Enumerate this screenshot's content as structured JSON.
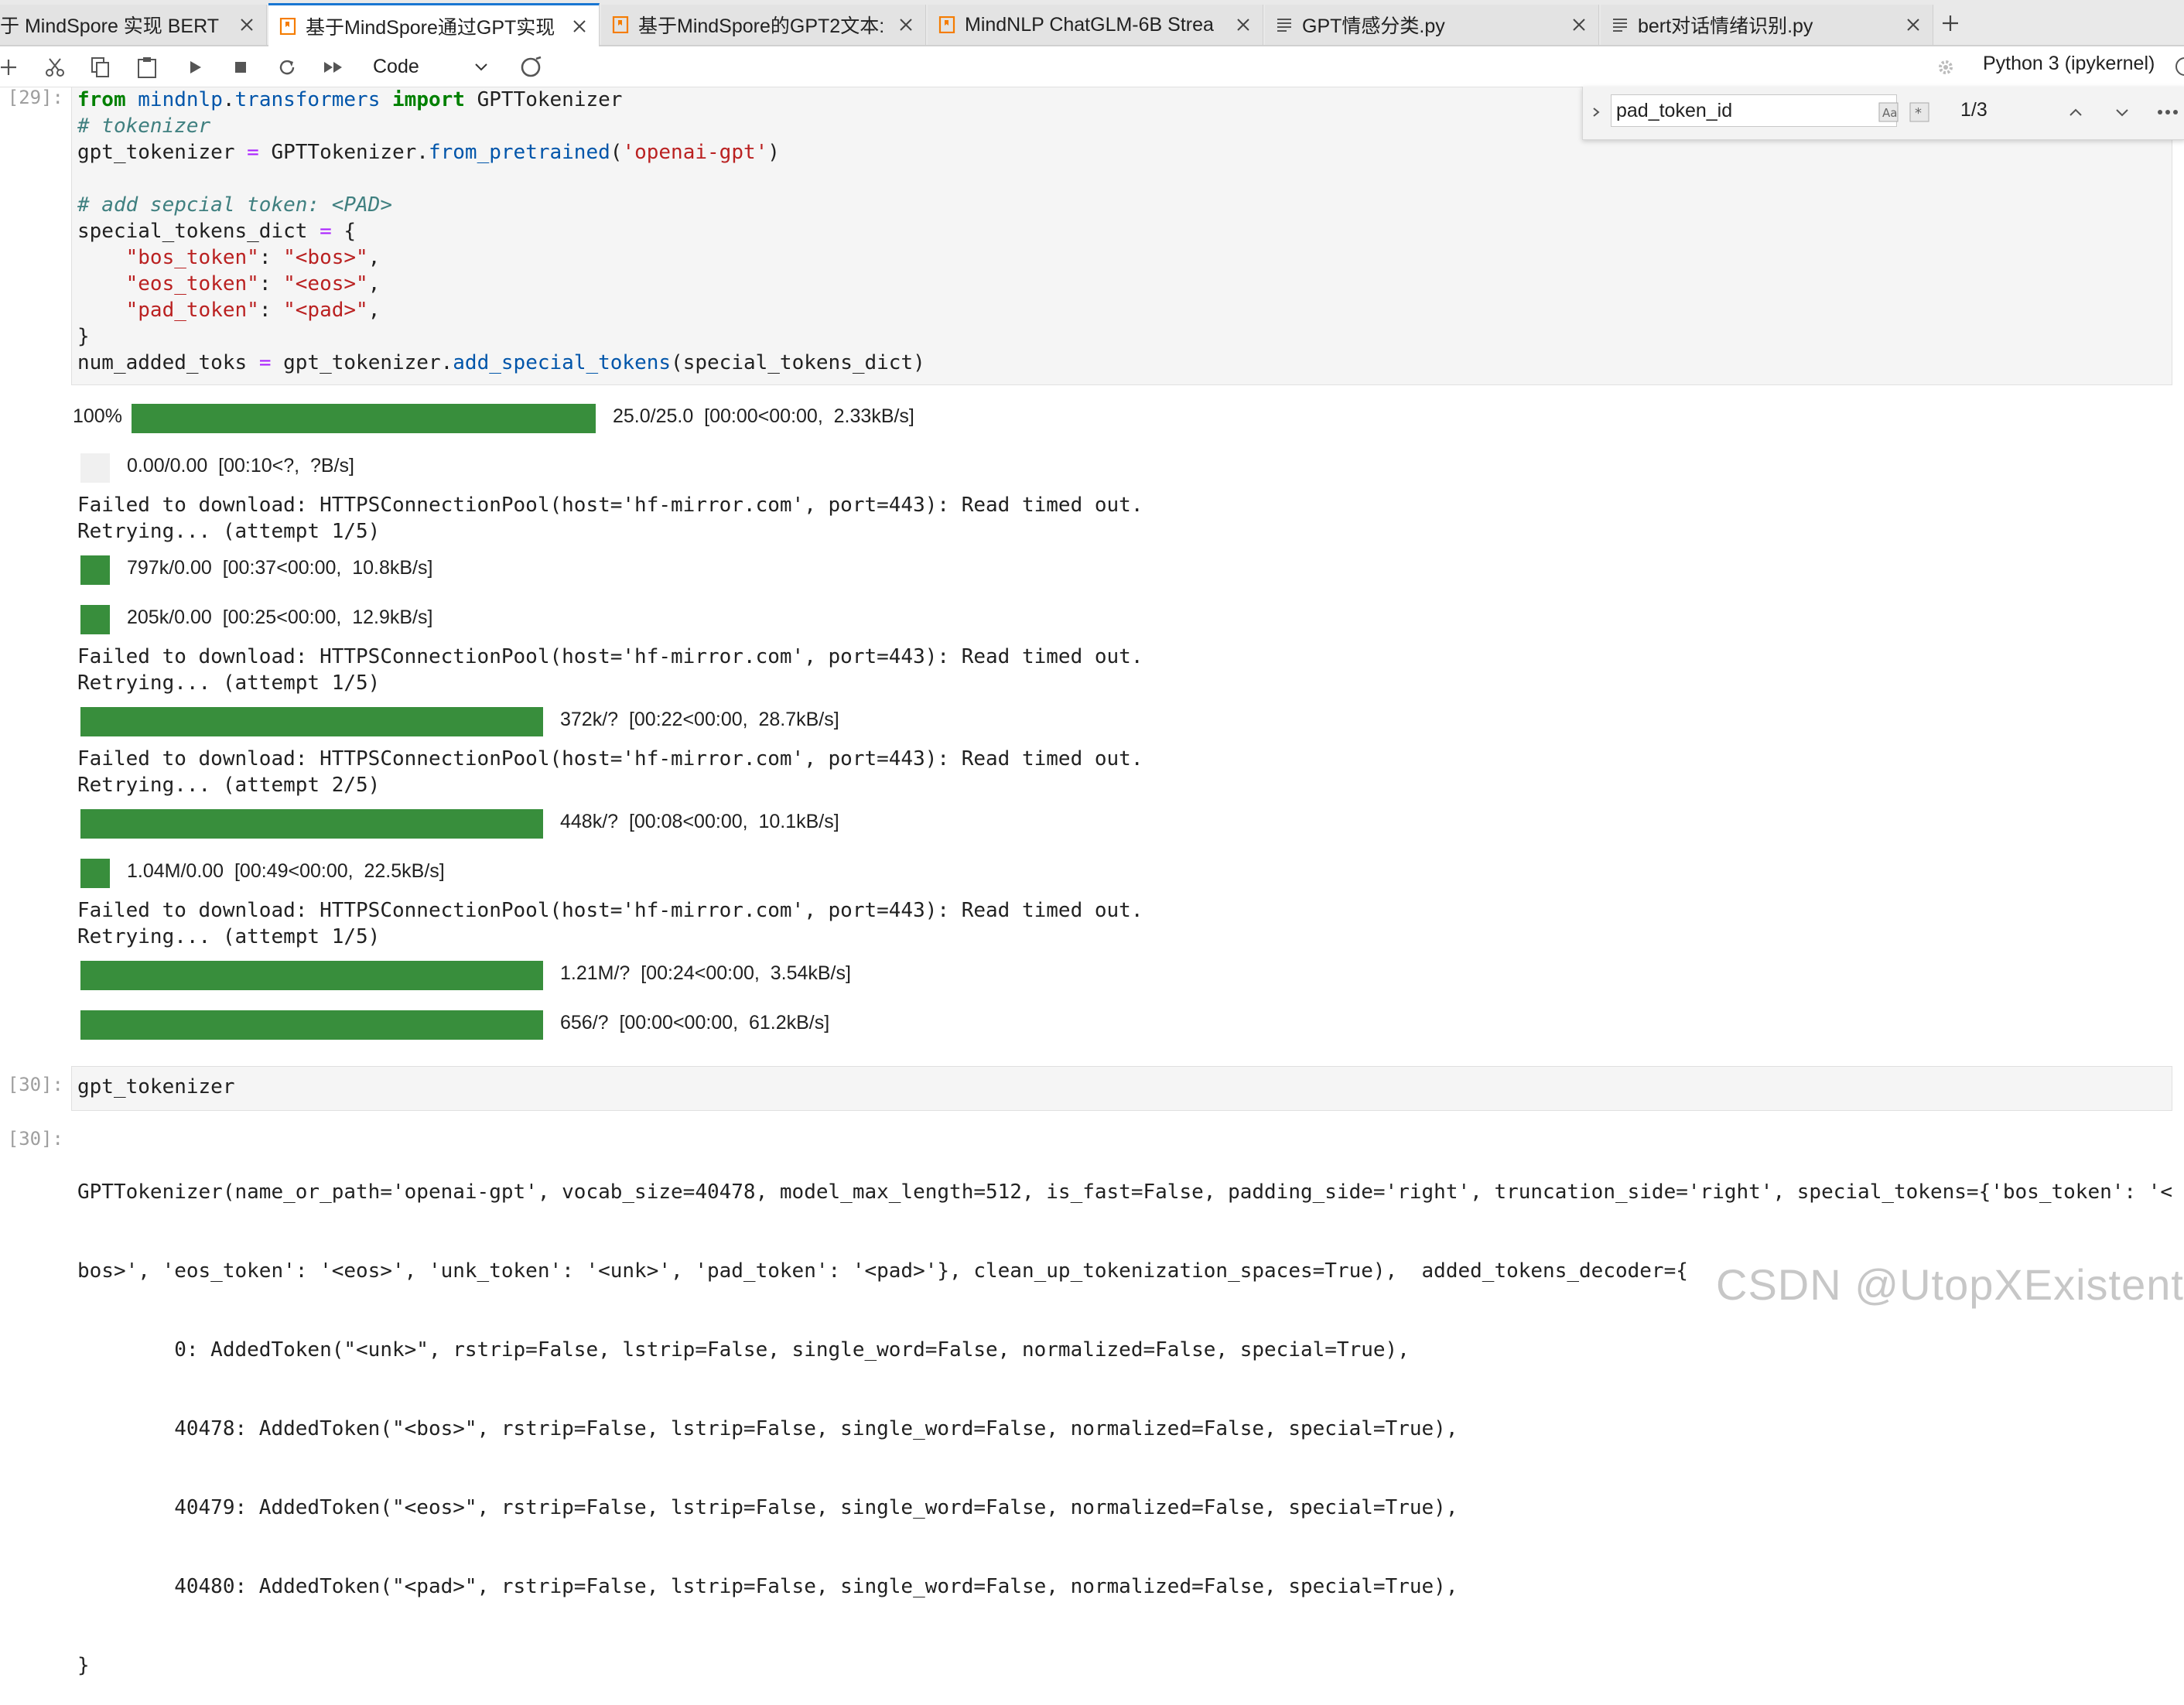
{
  "tabs": [
    {
      "label": "于 MindSpore 实现 BERT",
      "icon": "notebook-icon",
      "active": false
    },
    {
      "label": "基于MindSpore通过GPT实现",
      "icon": "notebook-icon",
      "active": true
    },
    {
      "label": "基于MindSpore的GPT2文本:",
      "icon": "notebook-icon",
      "active": false
    },
    {
      "label": "MindNLP ChatGLM-6B Strea",
      "icon": "notebook-icon",
      "active": false
    },
    {
      "label": "GPT情感分类.py",
      "icon": "file-text-icon",
      "active": false
    },
    {
      "label": "bert对话情绪识别.py",
      "icon": "file-text-icon",
      "active": false
    }
  ],
  "toolbar": {
    "cell_type": "Code",
    "kernel": "Python 3 (ipykernel)"
  },
  "find": {
    "query": "pad_token_id",
    "count": "1/3"
  },
  "cell29": {
    "prompt": "[29]:",
    "code": [
      "from mindnlp.transformers import GPTTokenizer",
      "# tokenizer",
      "gpt_tokenizer = GPTTokenizer.from_pretrained('openai-gpt')",
      "",
      "# add sepcial token: <PAD>",
      "special_tokens_dict = {",
      "    \"bos_token\": \"<bos>\",",
      "    \"eos_token\": \"<eos>\",",
      "    \"pad_token\": \"<pad>\",",
      "}",
      "num_added_toks = gpt_tokenizer.add_special_tokens(special_tokens_dict)"
    ]
  },
  "outputs29": {
    "progress": [
      {
        "pct": "100%",
        "fraction": 1.0,
        "info": "25.0/25.0  [00:00<00:00,  2.33kB/s]"
      },
      {
        "pct": "",
        "fraction": 0.0,
        "info": "0.00/0.00  [00:10<?,  ?B/s]"
      },
      {
        "pct": "",
        "fraction": 1.0,
        "info": "797k/0.00  [00:37<00:00,  10.8kB/s]"
      },
      {
        "pct": "",
        "fraction": 1.0,
        "info": "205k/0.00  [00:25<00:00,  12.9kB/s]"
      },
      {
        "pct": "",
        "fraction": 1.0,
        "info": "372k/?  [00:22<00:00,  28.7kB/s]"
      },
      {
        "pct": "",
        "fraction": 1.0,
        "info": "448k/?  [00:08<00:00,  10.1kB/s]"
      },
      {
        "pct": "",
        "fraction": 1.0,
        "info": "1.04M/0.00  [00:49<00:00,  22.5kB/s]"
      },
      {
        "pct": "",
        "fraction": 1.0,
        "info": "1.21M/?  [00:24<00:00,  3.54kB/s]"
      },
      {
        "pct": "",
        "fraction": 1.0,
        "info": "656/?  [00:00<00:00,  61.2kB/s]"
      }
    ],
    "messages": [
      [
        "Failed to download: HTTPSConnectionPool(host='hf-mirror.com', port=443): Read timed out.",
        "Retrying... (attempt 1/5)"
      ],
      [
        "Failed to download: HTTPSConnectionPool(host='hf-mirror.com', port=443): Read timed out.",
        "Retrying... (attempt 1/5)"
      ],
      [
        "Failed to download: HTTPSConnectionPool(host='hf-mirror.com', port=443): Read timed out.",
        "Retrying... (attempt 2/5)"
      ],
      [
        "Failed to download: HTTPSConnectionPool(host='hf-mirror.com', port=443): Read timed out.",
        "Retrying... (attempt 1/5)"
      ]
    ]
  },
  "cell30": {
    "prompt": "[30]:",
    "code": "gpt_tokenizer",
    "out_prompt": "[30]:",
    "output": [
      "GPTTokenizer(name_or_path='openai-gpt', vocab_size=40478, model_max_length=512, is_fast=False, padding_side='right', truncation_side='right', special_tokens={'bos_token': '<",
      "bos>', 'eos_token': '<eos>', 'unk_token': '<unk>', 'pad_token': '<pad>'}, clean_up_tokenization_spaces=True),  added_tokens_decoder={",
      "        0: AddedToken(\"<unk>\", rstrip=False, lstrip=False, single_word=False, normalized=False, special=True),",
      "        40478: AddedToken(\"<bos>\", rstrip=False, lstrip=False, single_word=False, normalized=False, special=True),",
      "        40479: AddedToken(\"<eos>\", rstrip=False, lstrip=False, single_word=False, normalized=False, special=True),",
      "        40480: AddedToken(\"<pad>\", rstrip=False, lstrip=False, single_word=False, normalized=False, special=True),",
      "}"
    ]
  },
  "watermark": "CSDN @UtopXExistential",
  "colors": {
    "progress": "#388e3c",
    "accent": "#1976d2"
  }
}
